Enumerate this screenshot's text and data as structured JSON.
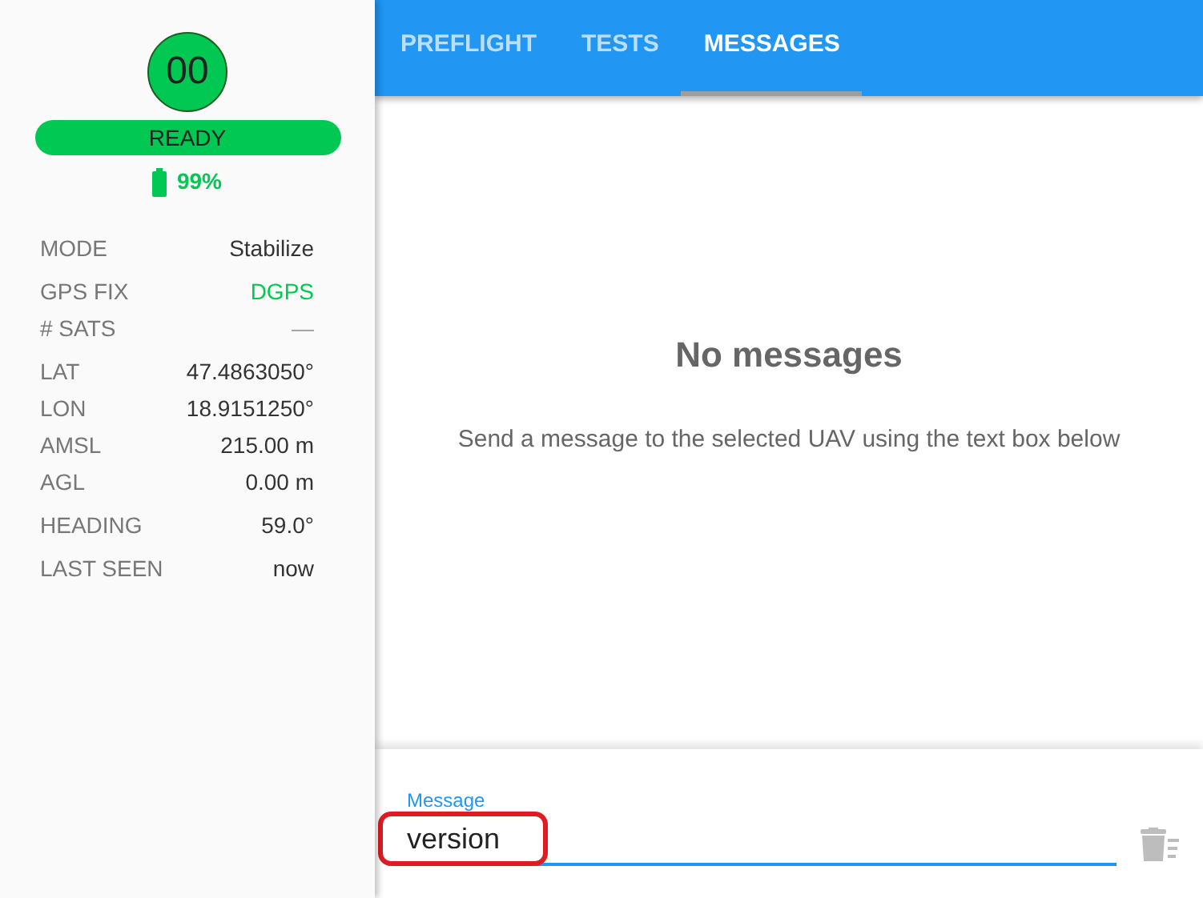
{
  "uav": {
    "id": "00",
    "status": "READY",
    "battery": "99%"
  },
  "properties": [
    [
      {
        "label": "MODE",
        "value": "Stabilize",
        "color": "#333333"
      }
    ],
    [
      {
        "label": "GPS FIX",
        "value": "DGPS",
        "color": "#00c853"
      },
      {
        "label": "# SATS",
        "value": "—",
        "color": "#9e9e9e"
      }
    ],
    [
      {
        "label": "LAT",
        "value": "47.4863050°",
        "color": "#333333"
      },
      {
        "label": "LON",
        "value": "18.9151250°",
        "color": "#333333"
      },
      {
        "label": "AMSL",
        "value": "215.00 m",
        "color": "#333333"
      },
      {
        "label": "AGL",
        "value": "0.00 m",
        "color": "#333333"
      }
    ],
    [
      {
        "label": "HEADING",
        "value": "59.0°",
        "color": "#333333"
      }
    ],
    [
      {
        "label": "LAST SEEN",
        "value": "now",
        "color": "#333333"
      }
    ]
  ],
  "tabs": [
    {
      "label": "PREFLIGHT",
      "selected": false
    },
    {
      "label": "TESTS",
      "selected": false
    },
    {
      "label": "MESSAGES",
      "selected": true
    }
  ],
  "empty_state": {
    "title": "No messages",
    "hint": "Send a message to the selected UAV using the text box below"
  },
  "composer": {
    "label": "Message",
    "value": "version",
    "highlighted": true
  }
}
